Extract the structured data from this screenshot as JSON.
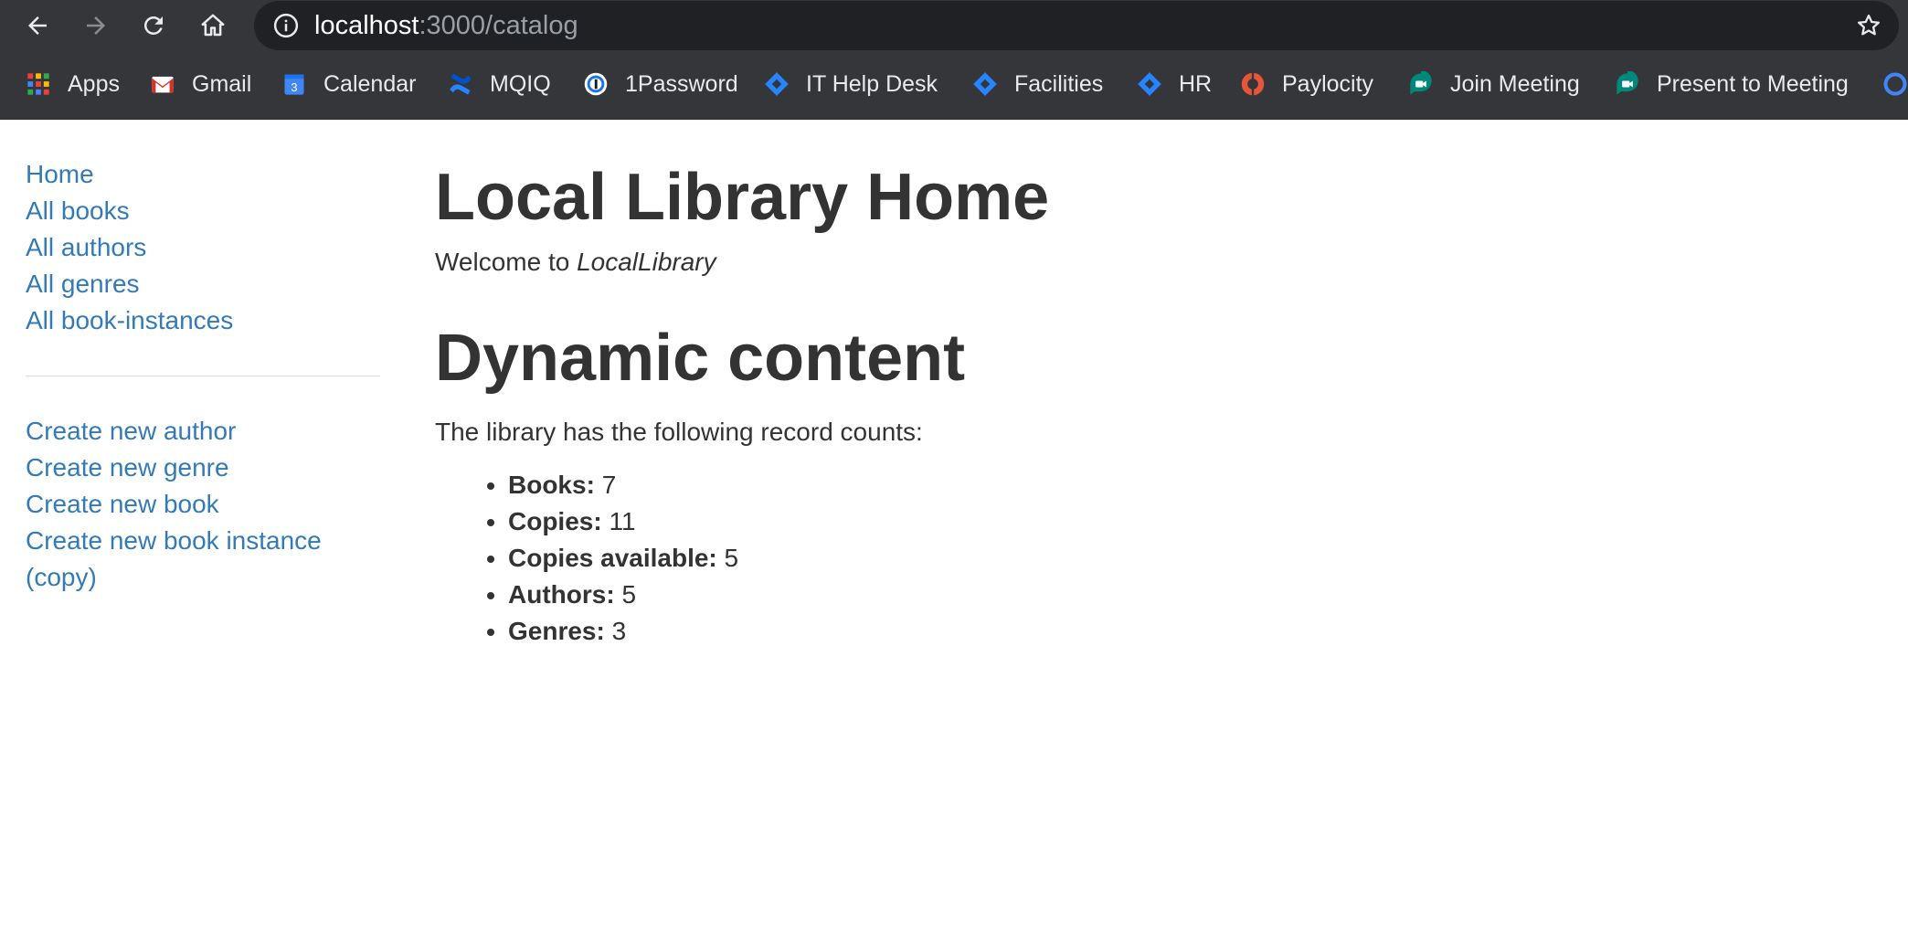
{
  "browser": {
    "url_host": "localhost",
    "url_path": ":3000/catalog",
    "bookmarks": [
      {
        "label": "Apps",
        "icon": "apps-grid-icon"
      },
      {
        "label": "Gmail",
        "icon": "gmail-icon"
      },
      {
        "label": "Calendar",
        "icon": "calendar-icon",
        "icon_text": "3"
      },
      {
        "label": "MQIQ",
        "icon": "confluence-icon"
      },
      {
        "label": "1Password",
        "icon": "1password-icon"
      },
      {
        "label": "IT Help Desk",
        "icon": "jira-icon"
      },
      {
        "label": "Facilities",
        "icon": "jira-icon"
      },
      {
        "label": "HR",
        "icon": "jira-icon"
      },
      {
        "label": "Paylocity",
        "icon": "paylocity-icon"
      },
      {
        "label": "Join Meeting",
        "icon": "meet-icon"
      },
      {
        "label": "Present to Meeting",
        "icon": "meet-icon"
      }
    ]
  },
  "sidebar": {
    "nav": [
      {
        "label": "Home"
      },
      {
        "label": "All books"
      },
      {
        "label": "All authors"
      },
      {
        "label": "All genres"
      },
      {
        "label": "All book-instances"
      }
    ],
    "create": [
      {
        "label": "Create new author"
      },
      {
        "label": "Create new genre"
      },
      {
        "label": "Create new book"
      },
      {
        "label": "Create new book instance (copy)"
      }
    ]
  },
  "main": {
    "title": "Local Library Home",
    "welcome_prefix": "Welcome to ",
    "welcome_name": "LocalLibrary",
    "section_title": "Dynamic content",
    "counts_intro": "The library has the following record counts:",
    "counts": [
      {
        "label": "Books:",
        "value": "7"
      },
      {
        "label": "Copies:",
        "value": "11"
      },
      {
        "label": "Copies available:",
        "value": "5"
      },
      {
        "label": "Authors:",
        "value": "5"
      },
      {
        "label": "Genres:",
        "value": "3"
      }
    ]
  },
  "colors": {
    "chrome_bg": "#35363a",
    "omnibox_bg": "#202124",
    "link": "#337ab7",
    "text": "#333333"
  }
}
